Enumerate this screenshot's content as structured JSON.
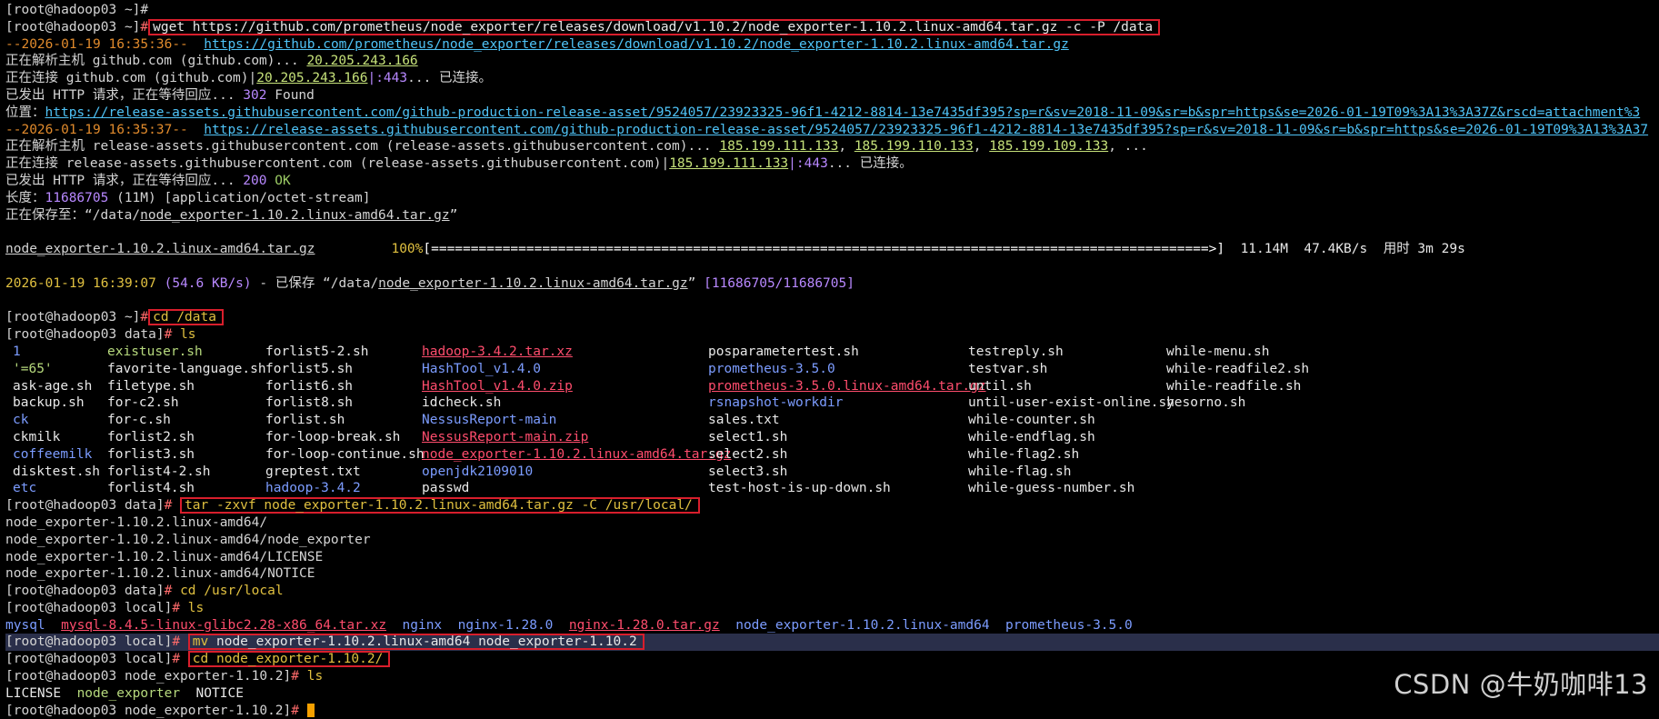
{
  "prompt_home": "[root@hadoop03 ~]",
  "prompt_data": "[root@hadoop03 data]",
  "prompt_local": "[root@hadoop03 local]",
  "prompt_ne": "[root@hadoop03 node_exporter-1.10.2]",
  "hash": "#",
  "wget": {
    "command": "wget https://github.com/prometheus/node_exporter/releases/download/v1.10.2/node_exporter-1.10.2.linux-amd64.tar.gz -c -P /data",
    "ts1": "--2026-01-19 16:35:36--",
    "url1": "https://github.com/prometheus/node_exporter/releases/download/v1.10.2/node_exporter-1.10.2.linux-amd64.tar.gz",
    "resolve1_pre": "正在解析主机 github.com (github.com)... ",
    "resolve1_ip": "20.205.243.166",
    "connect1_pre": "正在连接 github.com (github.com)|",
    "connect1_ip": "20.205.243.166",
    "connect1_port": "|:443",
    "connect1_post": "... 已连接。",
    "http1_pre": "已发出 HTTP 请求，正在等待回应... ",
    "http1_code": "302",
    "http1_msg": " Found",
    "location_label": "位置：",
    "location_url": "https://release-assets.githubusercontent.com/github-production-release-asset/9524057/23923325-96f1-4212-8814-13e7435df395?sp=r&sv=2018-11-09&sr=b&spr=https&se=2026-01-19T09%3A13%3A37Z&rscd=attachment%3",
    "ts2": "--2026-01-19 16:35:37--",
    "url2": "https://release-assets.githubusercontent.com/github-production-release-asset/9524057/23923325-96f1-4212-8814-13e7435df395?sp=r&sv=2018-11-09&sr=b&spr=https&se=2026-01-19T09%3A13%3A37",
    "resolve2_pre": "正在解析主机 release-assets.githubusercontent.com (release-assets.githubusercontent.com)... ",
    "resolve2_ip1": "185.199.111.133",
    "resolve2_ip2": "185.199.110.133",
    "resolve2_ip3": "185.199.109.133",
    "resolve2_post": ", ...",
    "sep": ", ",
    "connect2_pre": "正在连接 release-assets.githubusercontent.com (release-assets.githubusercontent.com)|",
    "connect2_ip": "185.199.111.133",
    "connect2_port": "|:443",
    "connect2_post": "... 已连接。",
    "http2_pre": "已发出 HTTP 请求，正在等待回应... ",
    "http2_code": "200",
    "http2_msg": " OK",
    "length_label": "长度：",
    "length_bytes": "11686705",
    "length_size": " (11M)",
    "length_type": " [application/octet-stream]",
    "saving_pre": "正在保存至：“/data/",
    "saving_file": "node_exporter-1.10.2.linux-amd64.tar.gz",
    "saving_post": "”",
    "progress_file": "node_exporter-1.10.2.linux-amd64.tar.gz",
    "progress_pct": "100%",
    "progress_bar": "[==================================================================================================>]",
    "progress_stats": "  11.14M  47.4KB/s  用时 3m 29s",
    "done_ts": "2026-01-19 16:39:07 ",
    "done_speed": "(54.6 KB/s)",
    "done_mid": " - 已保存 “/data/",
    "done_file": "node_exporter-1.10.2.linux-amd64.tar.gz",
    "done_post": "” ",
    "done_bytes": "[11686705/11686705]"
  },
  "cd_data": "cd /data",
  "ls_cmd": "ls",
  "ls_data": [
    [
      {
        "t": "1",
        "c": "dir"
      },
      {
        "t": "existuser.sh",
        "c": "exec"
      },
      {
        "t": "forlist5-2.sh",
        "c": "white"
      },
      {
        "t": "hadoop-3.4.2.tar.xz",
        "c": "pink"
      },
      {
        "t": "posparametertest.sh",
        "c": "white"
      },
      {
        "t": "testreply.sh",
        "c": "white"
      },
      {
        "t": "while-menu.sh",
        "c": "white"
      }
    ],
    [
      {
        "t": "'=65'",
        "c": "exec"
      },
      {
        "t": "favorite-language.sh",
        "c": "white"
      },
      {
        "t": "forlist5.sh",
        "c": "white"
      },
      {
        "t": "HashTool_v1.4.0",
        "c": "dir"
      },
      {
        "t": "prometheus-3.5.0",
        "c": "dir"
      },
      {
        "t": "testvar.sh",
        "c": "white"
      },
      {
        "t": "while-readfile2.sh",
        "c": "white"
      }
    ],
    [
      {
        "t": "ask-age.sh",
        "c": "white"
      },
      {
        "t": "filetype.sh",
        "c": "white"
      },
      {
        "t": "forlist6.sh",
        "c": "white"
      },
      {
        "t": "HashTool_v1.4.0.zip",
        "c": "pink"
      },
      {
        "t": "prometheus-3.5.0.linux-amd64.tar.gz",
        "c": "pink"
      },
      {
        "t": "until.sh",
        "c": "white"
      },
      {
        "t": "while-readfile.sh",
        "c": "white"
      }
    ],
    [
      {
        "t": "backup.sh",
        "c": "white"
      },
      {
        "t": "for-c2.sh",
        "c": "white"
      },
      {
        "t": "forlist8.sh",
        "c": "white"
      },
      {
        "t": "idcheck.sh",
        "c": "white"
      },
      {
        "t": "rsnapshot-workdir",
        "c": "dir"
      },
      {
        "t": "until-user-exist-online.sh",
        "c": "white"
      },
      {
        "t": "yesorno.sh",
        "c": "white"
      }
    ],
    [
      {
        "t": "ck",
        "c": "dir"
      },
      {
        "t": "for-c.sh",
        "c": "white"
      },
      {
        "t": "forlist.sh",
        "c": "white"
      },
      {
        "t": "NessusReport-main",
        "c": "dir"
      },
      {
        "t": "sales.txt",
        "c": "white"
      },
      {
        "t": "while-counter.sh",
        "c": "white"
      },
      {
        "t": "",
        "c": "white"
      }
    ],
    [
      {
        "t": "ckmilk",
        "c": "white"
      },
      {
        "t": "forlist2.sh",
        "c": "white"
      },
      {
        "t": "for-loop-break.sh",
        "c": "white"
      },
      {
        "t": "NessusReport-main.zip",
        "c": "pink"
      },
      {
        "t": "select1.sh",
        "c": "white"
      },
      {
        "t": "while-endflag.sh",
        "c": "white"
      },
      {
        "t": "",
        "c": "white"
      }
    ],
    [
      {
        "t": "coffeemilk",
        "c": "dir"
      },
      {
        "t": "forlist3.sh",
        "c": "white"
      },
      {
        "t": "for-loop-continue.sh",
        "c": "white"
      },
      {
        "t": "node_exporter-1.10.2.linux-amd64.tar.gz",
        "c": "pink"
      },
      {
        "t": "select2.sh",
        "c": "white"
      },
      {
        "t": "while-flag2.sh",
        "c": "white"
      },
      {
        "t": "",
        "c": "white"
      }
    ],
    [
      {
        "t": "disktest.sh",
        "c": "white"
      },
      {
        "t": "forlist4-2.sh",
        "c": "white"
      },
      {
        "t": "greptest.txt",
        "c": "white"
      },
      {
        "t": "openjdk2109010",
        "c": "dir"
      },
      {
        "t": "select3.sh",
        "c": "white"
      },
      {
        "t": "while-flag.sh",
        "c": "white"
      },
      {
        "t": "",
        "c": "white"
      }
    ],
    [
      {
        "t": "etc",
        "c": "dir"
      },
      {
        "t": "forlist4.sh",
        "c": "white"
      },
      {
        "t": "hadoop-3.4.2",
        "c": "dir"
      },
      {
        "t": "passwd",
        "c": "white"
      },
      {
        "t": "test-host-is-up-down.sh",
        "c": "white"
      },
      {
        "t": "while-guess-number.sh",
        "c": "white"
      },
      {
        "t": "",
        "c": "white"
      }
    ]
  ],
  "tar_cmd": "tar -zxvf node_exporter-1.10.2.linux-amd64.tar.gz -C /usr/local/",
  "tar_out": [
    "node_exporter-1.10.2.linux-amd64/",
    "node_exporter-1.10.2.linux-amd64/node_exporter",
    "node_exporter-1.10.2.linux-amd64/LICENSE",
    "node_exporter-1.10.2.linux-amd64/NOTICE"
  ],
  "cd_local": "cd /usr/local",
  "ls_local": [
    {
      "t": "mysql",
      "c": "dir"
    },
    {
      "t": "mysql-8.4.5-linux-glibc2.28-x86_64.tar.xz",
      "c": "pink"
    },
    {
      "t": "nginx",
      "c": "dir"
    },
    {
      "t": "nginx-1.28.0",
      "c": "dir"
    },
    {
      "t": "nginx-1.28.0.tar.gz",
      "c": "pink"
    },
    {
      "t": "node_exporter-1.10.2.linux-amd64",
      "c": "dir"
    },
    {
      "t": "prometheus-3.5.0",
      "c": "dir"
    }
  ],
  "mv_cmd_a": "mv",
  "mv_cmd_b": " node_exporter-1.10.2.linux-amd64 node_exporter-1.10.2",
  "cd_ne": "cd node_exporter-1.10.2/",
  "ls_ne": [
    {
      "t": "LICENSE",
      "c": "white"
    },
    {
      "t": "node_exporter",
      "c": "exec"
    },
    {
      "t": "NOTICE",
      "c": "white"
    }
  ],
  "watermark": "CSDN @牛奶咖啡13",
  "colors": {
    "background": "#000000",
    "box": "#d81e2c",
    "cursor": "#f5a000"
  }
}
